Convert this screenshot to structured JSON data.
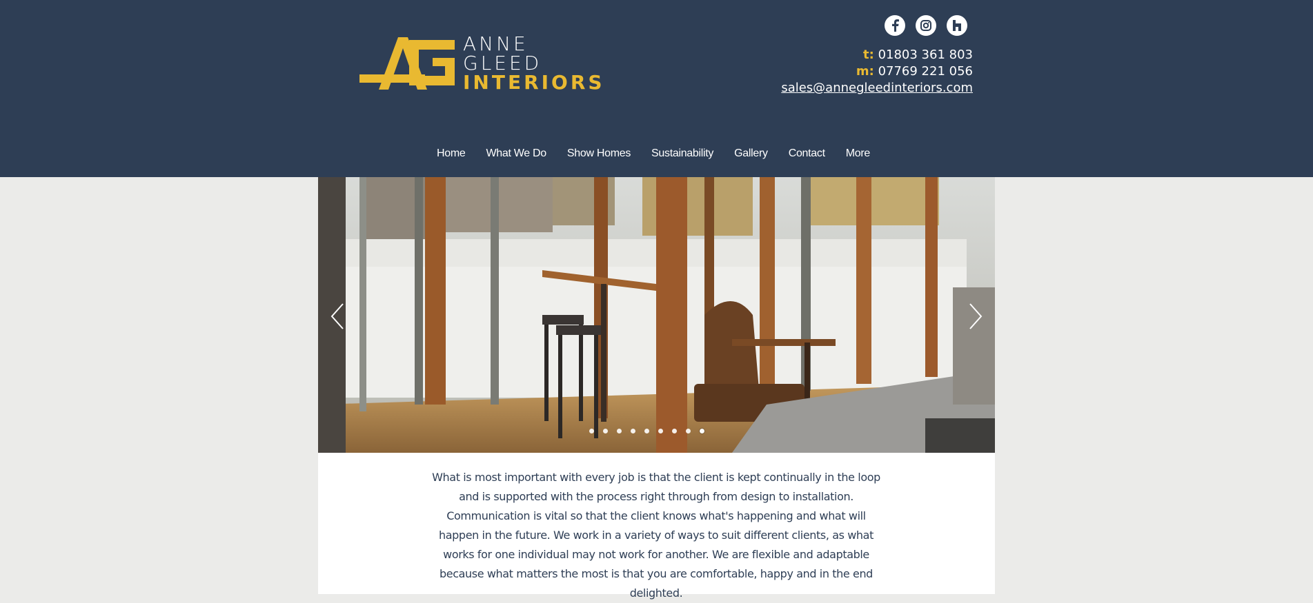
{
  "brand": {
    "monogram": "AG",
    "line1": "ANNE",
    "line2": "GLEED",
    "line3": "INTERIORS",
    "accent_color": "#e9b931",
    "header_color": "#2e3e55"
  },
  "social": [
    {
      "name": "facebook",
      "icon": "facebook-icon"
    },
    {
      "name": "instagram",
      "icon": "instagram-icon"
    },
    {
      "name": "houzz",
      "icon": "houzz-icon"
    }
  ],
  "contact": {
    "tel_label": "t:",
    "tel": "01803 361 803",
    "mobile_label": "m:",
    "mobile": "07769 221 056",
    "email": "sales@annegleedinteriors.com"
  },
  "nav": {
    "items": [
      "Home",
      "What We Do",
      "Show Homes",
      "Sustainability",
      "Gallery",
      "Contact",
      "More"
    ]
  },
  "slider": {
    "prev_icon": "chevron-left-icon",
    "next_icon": "chevron-right-icon",
    "slide_count": 9,
    "active_index": 8
  },
  "main": {
    "text": "What is most important with every job is that the client is kept continually in the loop and is supported with the process right through from design to installation. Communication is vital so that the client knows what's happening and what will happen in the future. We work in a variety of ways to suit different clients, as what works for one individual may not work for another. We are flexible and adaptable because what matters the most is that you are comfortable, happy and in the end delighted."
  }
}
